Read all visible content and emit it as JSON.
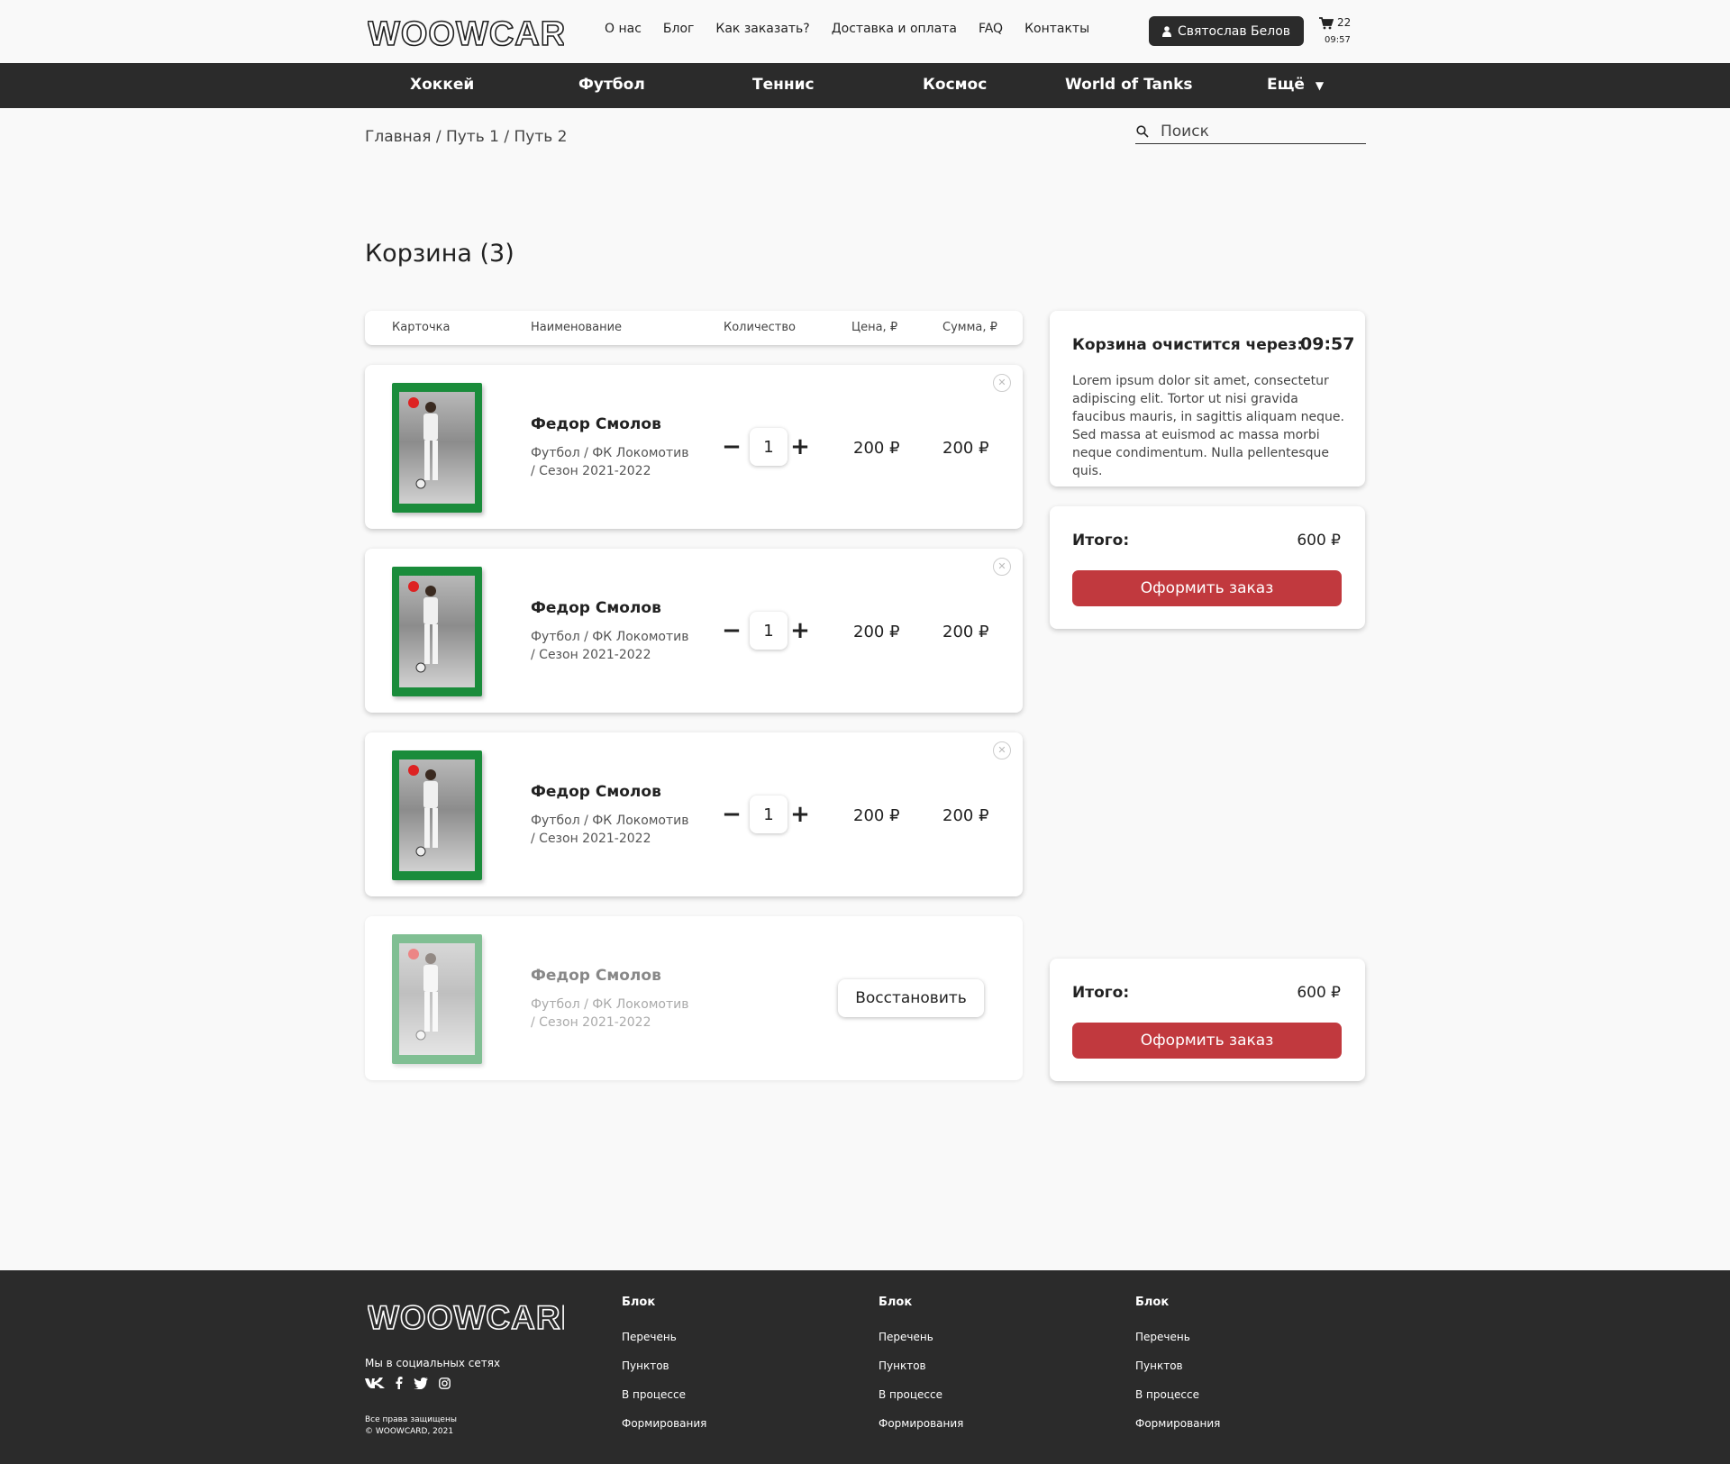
{
  "header": {
    "brand": "WOOWCARD",
    "nav": [
      "О нас",
      "Блог",
      "Как заказать?",
      "Доставка и оплата",
      "FAQ",
      "Контакты"
    ],
    "user_name": "Святослав Белов",
    "cart_count": "22",
    "cart_time": "09:57"
  },
  "categories": [
    "Хоккей",
    "Футбол",
    "Теннис",
    "Космос",
    "World of Tanks",
    "Ещё"
  ],
  "breadcrumb": "Главная / Путь 1 / Путь 2",
  "search": {
    "placeholder": "Поиск"
  },
  "page_title": "Корзина (3)",
  "table_head": {
    "card": "Карточка",
    "name": "Наименование",
    "qty": "Количество",
    "price": "Цена, ₽",
    "sum": "Сумма, ₽"
  },
  "items": [
    {
      "name": "Федор Смолов",
      "sub": "Футбол / ФК Локомотив / Сезон 2021-2022",
      "qty": "1",
      "price": "200 ₽",
      "sum": "200 ₽"
    },
    {
      "name": "Федор Смолов",
      "sub": "Футбол / ФК Локомотив / Сезон 2021-2022",
      "qty": "1",
      "price": "200 ₽",
      "sum": "200 ₽"
    },
    {
      "name": "Федор Смолов",
      "sub": "Футбол / ФК Локомотив / Сезон 2021-2022",
      "qty": "1",
      "price": "200 ₽",
      "sum": "200 ₽"
    }
  ],
  "removed_item": {
    "name": "Федор Смолов",
    "sub": "Футбол / ФК Локомотив / Сезон 2021-2022",
    "restore_label": "Восстановить"
  },
  "timer_panel": {
    "title": "Корзина очистится через:",
    "time": "09:57",
    "text": "Lorem ipsum dolor sit amet, consectetur adipiscing elit. Tortor ut nisi gravida faucibus mauris, in sagittis aliquam neque. Sed massa at euismod ac massa morbi neque condimentum. Nulla pellentesque quis."
  },
  "total": {
    "label": "Итого:",
    "value": "600 ₽",
    "button": "Оформить заказ"
  },
  "footer": {
    "brand": "WOOWCARD",
    "social_title": "Мы в социальных сетях",
    "copyright_line1": "Все права защищены",
    "copyright_line2": "© WOOWCARD, 2021",
    "columns": [
      {
        "title": "Блок",
        "links": [
          "Перечень",
          "Пунктов",
          "В процессе",
          "Формирования"
        ]
      },
      {
        "title": "Блок",
        "links": [
          "Перечень",
          "Пунктов",
          "В процессе",
          "Формирования"
        ]
      },
      {
        "title": "Блок",
        "links": [
          "Перечень",
          "Пунктов",
          "В процессе",
          "Формирования"
        ]
      }
    ]
  },
  "colors": {
    "accent": "#c1393e",
    "dark": "#2b2b2b",
    "card_green": "#1a8c3b",
    "background": "#f9f9f9"
  }
}
